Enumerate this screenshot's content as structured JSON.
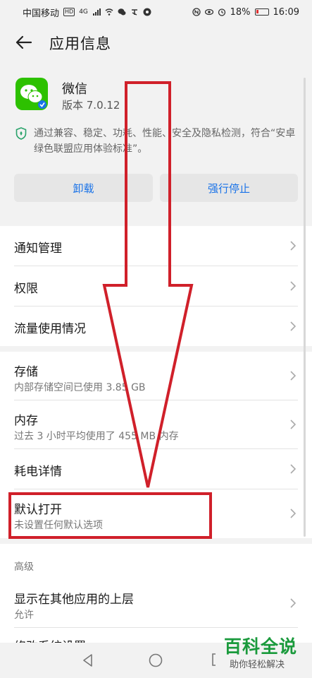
{
  "status_bar": {
    "carrier": "中国移动",
    "badge": "HD",
    "network": "4G",
    "battery": "18%",
    "time": "16:09"
  },
  "header": {
    "title": "应用信息"
  },
  "app": {
    "name": "微信",
    "version": "版本 7.0.12",
    "certification": "通过兼容、稳定、功耗、性能、安全及隐私检测，符合“安卓绿色联盟应用体验标准”。"
  },
  "buttons": {
    "uninstall": "卸载",
    "force_stop": "强行停止"
  },
  "section1": {
    "items": [
      {
        "label": "通知管理"
      },
      {
        "label": "权限"
      },
      {
        "label": "流量使用情况"
      }
    ]
  },
  "section2": {
    "items": [
      {
        "label": "存储",
        "sub": "内部存储空间已使用 3.85 GB"
      },
      {
        "label": "内存",
        "sub": "过去 3 小时平均使用了 455 MB 内存"
      },
      {
        "label": "耗电详情"
      },
      {
        "label": "默认打开",
        "sub": "未设置任何默认选项"
      }
    ]
  },
  "section3": {
    "title": "高级",
    "items": [
      {
        "label": "显示在其他应用的上层",
        "sub": "允许"
      },
      {
        "label": "修改系统设置"
      }
    ]
  },
  "watermark": {
    "title": "百科全说",
    "subtitle": "助你轻松解决"
  },
  "colors": {
    "accent": "#1a73e8",
    "annotation": "#d0202a",
    "wechat_green": "#2dc100",
    "watermark_green": "#1a9a3c"
  }
}
